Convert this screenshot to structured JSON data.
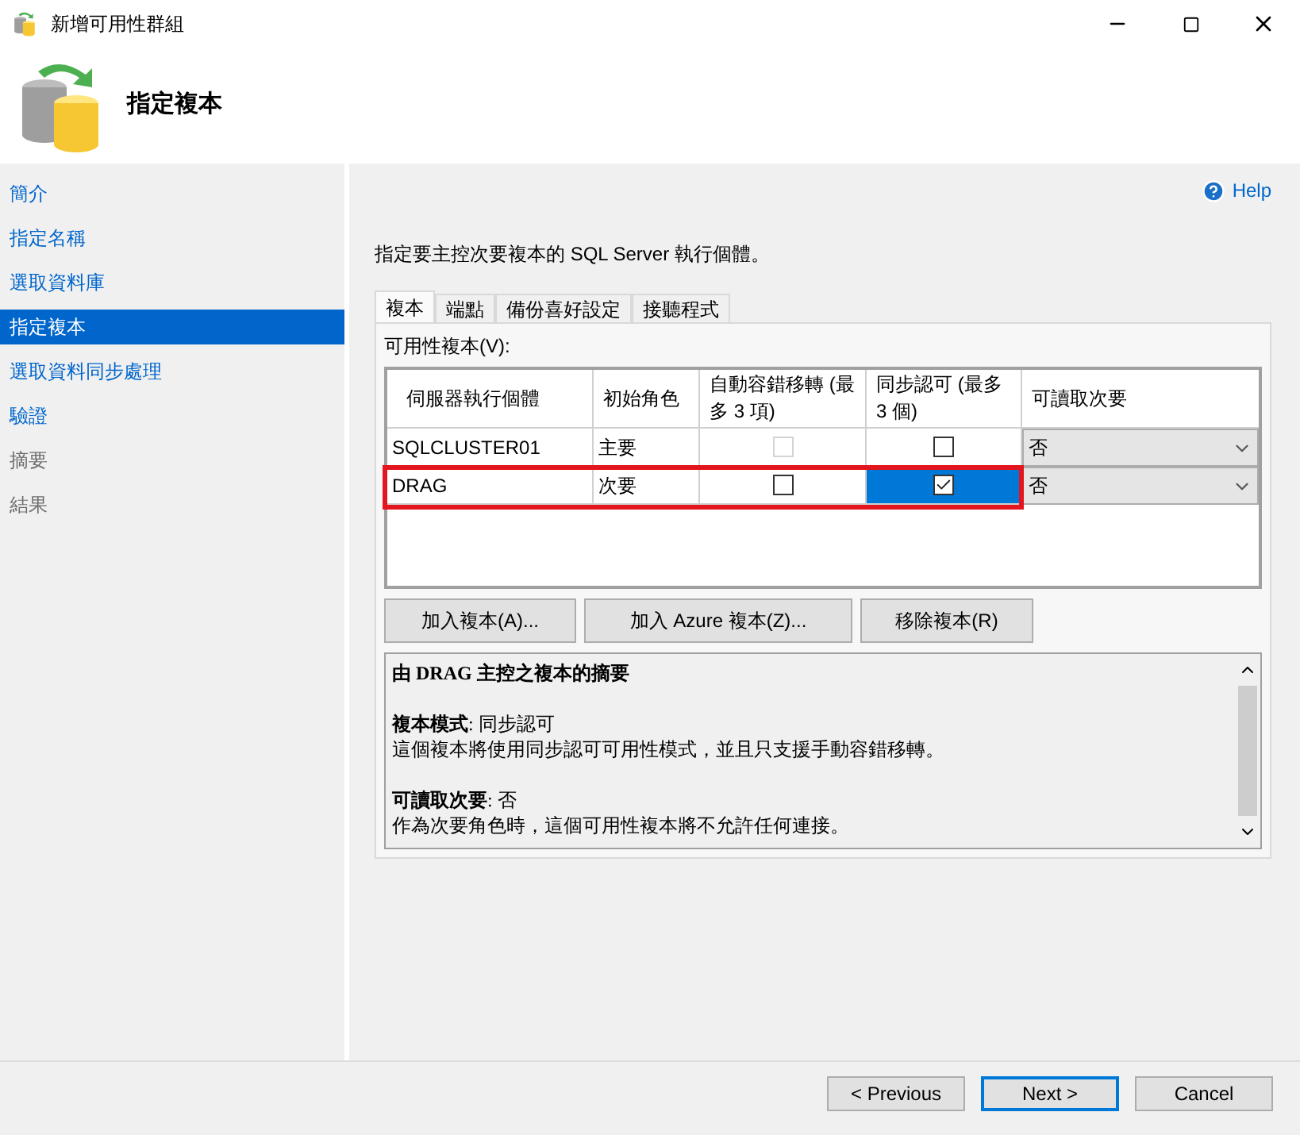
{
  "window": {
    "title": "新增可用性群組"
  },
  "header": {
    "title": "指定複本"
  },
  "help": "Help",
  "sidebar": {
    "items": [
      {
        "label": "簡介",
        "selected": false,
        "disabled": false
      },
      {
        "label": "指定名稱",
        "selected": false,
        "disabled": false
      },
      {
        "label": "選取資料庫",
        "selected": false,
        "disabled": false
      },
      {
        "label": "指定複本",
        "selected": true,
        "disabled": false
      },
      {
        "label": "選取資料同步處理",
        "selected": false,
        "disabled": false
      },
      {
        "label": "驗證",
        "selected": false,
        "disabled": false
      },
      {
        "label": "摘要",
        "selected": false,
        "disabled": true
      },
      {
        "label": "結果",
        "selected": false,
        "disabled": true
      }
    ]
  },
  "instruction": "指定要主控次要複本的 SQL Server 執行個體。",
  "tabs": [
    {
      "label": "複本",
      "selected": true
    },
    {
      "label": "端點",
      "selected": false
    },
    {
      "label": "備份喜好設定",
      "selected": false
    },
    {
      "label": "接聽程式",
      "selected": false
    }
  ],
  "table": {
    "label": "可用性複本(V):",
    "columns": [
      "伺服器執行個體",
      "初始角色",
      "自動容錯移轉 (最多 3 項)",
      "同步認可 (最多 3 個)",
      "可讀取次要"
    ],
    "rows": [
      {
        "server": "SQLCLUSTER01",
        "role": "主要",
        "auto_failover": {
          "checked": false,
          "disabled": true
        },
        "sync_commit": {
          "checked": false,
          "selected": false
        },
        "readable": "否",
        "highlighted": false
      },
      {
        "server": "DRAG",
        "role": "次要",
        "auto_failover": {
          "checked": false,
          "disabled": false
        },
        "sync_commit": {
          "checked": true,
          "selected": true
        },
        "readable": "否",
        "highlighted": true
      }
    ]
  },
  "buttons": [
    "加入複本(A)...",
    "加入 Azure 複本(Z)...",
    "移除複本(R)"
  ],
  "summary": {
    "title": "由 DRAG 主控之複本的摘要",
    "sections": [
      {
        "heading": "**複本模式**: 同步認可",
        "text": "這個複本將使用同步認可可用性模式，並且只支援手動容錯移轉。"
      },
      {
        "heading": "**可讀取次要**: 否",
        "text": "作為次要角色時，這個可用性複本將不允許任何連接。"
      }
    ]
  },
  "footer": [
    {
      "label": "< Previous",
      "default": false
    },
    {
      "label": "Next >",
      "default": true
    },
    {
      "label": "Cancel",
      "default": false
    }
  ]
}
